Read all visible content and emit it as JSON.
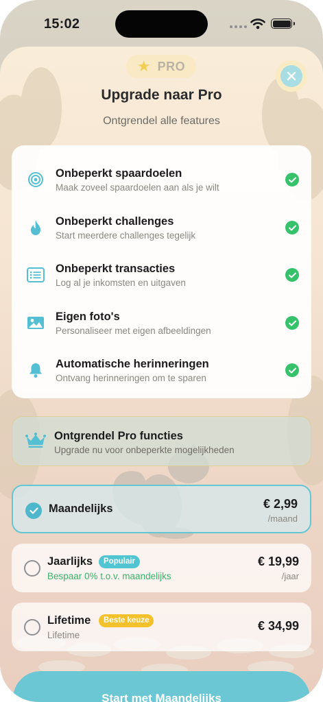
{
  "status_bar": {
    "time": "15:02"
  },
  "header": {
    "badge_label": "PRO",
    "title": "Upgrade naar Pro",
    "subtitle": "Ontgrendel alle features"
  },
  "features": [
    {
      "icon": "target-icon",
      "title": "Onbeperkt spaardoelen",
      "description": "Maak zoveel spaardoelen aan als je wilt"
    },
    {
      "icon": "flame-icon",
      "title": "Onbeperkt challenges",
      "description": "Start meerdere challenges tegelijk"
    },
    {
      "icon": "list-icon",
      "title": "Onbeperkt transacties",
      "description": "Log al je inkomsten en uitgaven"
    },
    {
      "icon": "photo-icon",
      "title": "Eigen foto's",
      "description": "Personaliseer met eigen afbeeldingen"
    },
    {
      "icon": "bell-icon",
      "title": "Automatische herinneringen",
      "description": "Ontvang herinneringen om te sparen"
    }
  ],
  "unlock": {
    "title": "Ontgrendel Pro functies",
    "description": "Upgrade nu voor onbeperkte mogelijkheden"
  },
  "plans": [
    {
      "name": "Maandelijks",
      "price": "€ 2,99",
      "period": "/maand",
      "selected": true
    },
    {
      "name": "Jaarlijks",
      "badge": "Populair",
      "subtitle": "Bespaar 0% t.o.v. maandelijks",
      "price": "€ 19,99",
      "period": "/jaar",
      "selected": false
    },
    {
      "name": "Lifetime",
      "badge": "Beste keuze",
      "subtitle": "Lifetime",
      "price": "€ 34,99",
      "selected": false
    }
  ],
  "cta_label": "Start met Maandelijks",
  "colors": {
    "accent_teal": "#6cc7d4",
    "check_green": "#36c16b",
    "badge_yellow": "#f2c12c",
    "savings_green": "#3bb36b"
  }
}
